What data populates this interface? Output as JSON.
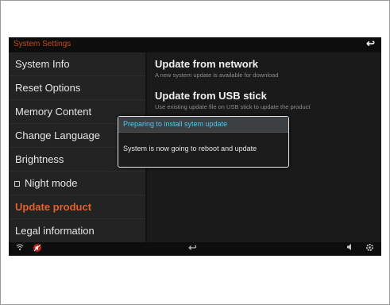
{
  "header": {
    "title": "System Settings",
    "back_icon": "↩"
  },
  "sidebar": {
    "items": [
      {
        "label": "System Info"
      },
      {
        "label": "Reset Options"
      },
      {
        "label": "Memory Content"
      },
      {
        "label": "Change Language"
      },
      {
        "label": "Brightness"
      },
      {
        "label": "Night mode"
      },
      {
        "label": "Update product"
      },
      {
        "label": "Legal information"
      }
    ]
  },
  "main": {
    "options": [
      {
        "title": "Update from network",
        "subtitle": "A new system update is available for download"
      },
      {
        "title": "Update from USB  stick",
        "subtitle": "Use existing update file on USB stick to update the product"
      }
    ]
  },
  "dialog": {
    "title": "Preparing to install sytem update",
    "message": "System is now going to reboot and update"
  },
  "bottombar": {
    "wifi_icon": "wifi-icon",
    "mute_icon": "mute-icon",
    "back_icon": "↩",
    "volume_icon": "volume-icon",
    "settings_icon": "gear-icon"
  },
  "colors": {
    "accent": "#e4622a",
    "dialog_title": "#59c1f0"
  }
}
